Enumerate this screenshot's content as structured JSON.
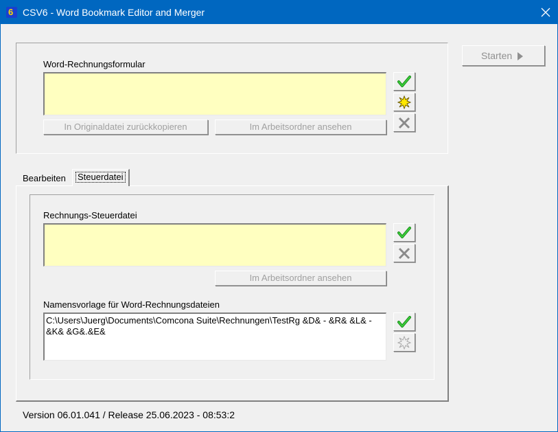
{
  "window": {
    "title": "CSV6 - Word Bookmark Editor and Merger",
    "app_icon_glyph": "6",
    "accent_color": "#0067c0"
  },
  "top_group": {
    "label": "Word-Rechnungsformular",
    "field_value": "",
    "copy_back_button": "In Originaldatei zurückkopieren",
    "view_in_workdir_button": "Im Arbeitsordner ansehen",
    "icons": [
      "check-icon",
      "burst-icon",
      "delete-x-icon"
    ]
  },
  "start_button": {
    "label": "Starten",
    "icon": "play-arrow-icon"
  },
  "tabs": [
    {
      "label": "Bearbeiten",
      "active": false
    },
    {
      "label": "Steuerdatei",
      "active": true
    }
  ],
  "steuer_group": {
    "label": "Rechnungs-Steuerdatei",
    "field_value": "",
    "view_in_workdir_button": "Im Arbeitsordner ansehen",
    "icons": [
      "check-icon",
      "delete-x-icon"
    ]
  },
  "name_template": {
    "label": "Namensvorlage für Word-Rechnungsdateien",
    "value": "C:\\Users\\Juerg\\Documents\\Comcona Suite\\Rechnungen\\TestRg &D& - &R& &L& - &K& &G&.&E&",
    "icons": [
      "check-icon",
      "burst-icon-disabled"
    ]
  },
  "status": {
    "text": "Version 06.01.041 / Release 25.06.2023 - 08:53:2"
  }
}
